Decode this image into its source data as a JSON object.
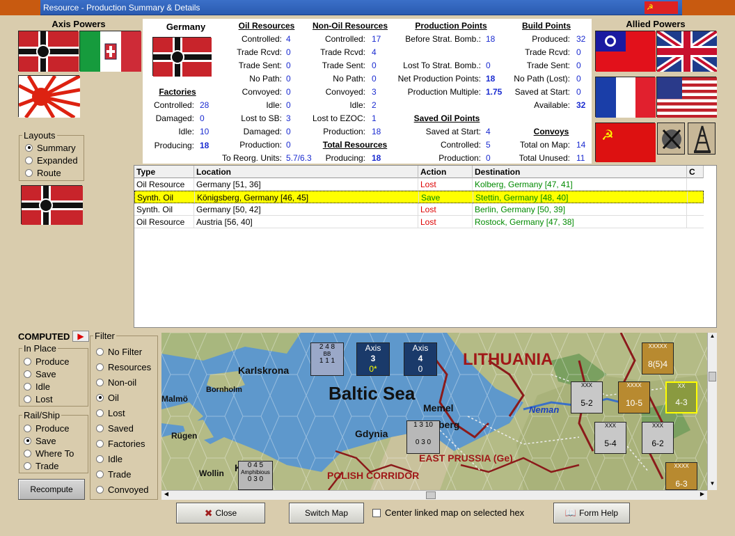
{
  "window": {
    "title": "Resource - Production Summary & Details"
  },
  "axis": {
    "title": "Axis Powers"
  },
  "allied": {
    "title": "Allied Powers"
  },
  "layouts": {
    "title": "Layouts",
    "options": [
      "Summary",
      "Expanded",
      "Route"
    ],
    "selected": "Summary"
  },
  "country": {
    "name": "Germany"
  },
  "factories": {
    "title": "Factories",
    "rows": [
      {
        "label": "Controlled:",
        "value": "28"
      },
      {
        "label": "Damaged:",
        "value": "0"
      },
      {
        "label": "Idle:",
        "value": "10"
      },
      {
        "label": "Producing:",
        "value": "18"
      }
    ]
  },
  "oil": {
    "title": "Oil Resources",
    "rows": [
      {
        "label": "Controlled:",
        "value": "4"
      },
      {
        "label": "Trade Rcvd:",
        "value": "0"
      },
      {
        "label": "Trade Sent:",
        "value": "0"
      },
      {
        "label": "No Path:",
        "value": "0"
      },
      {
        "label": "Convoyed:",
        "value": "0"
      },
      {
        "label": "Idle:",
        "value": "0"
      },
      {
        "label": "Lost to SB:",
        "value": "3"
      },
      {
        "label": "Damaged:",
        "value": "0"
      },
      {
        "label": "Production:",
        "value": "0"
      },
      {
        "label": "To Reorg. Units:",
        "value": "5.7/6.3"
      }
    ]
  },
  "nonoil": {
    "title": "Non-Oil Resources",
    "rows": [
      {
        "label": "Controlled:",
        "value": "17"
      },
      {
        "label": "Trade Rcvd:",
        "value": "4"
      },
      {
        "label": "Trade Sent:",
        "value": "0"
      },
      {
        "label": "No Path:",
        "value": "0"
      },
      {
        "label": "Convoyed:",
        "value": "3"
      },
      {
        "label": "Idle:",
        "value": "2"
      },
      {
        "label": "Lost to EZOC:",
        "value": "1"
      },
      {
        "label": "Production:",
        "value": "18"
      }
    ]
  },
  "total": {
    "title": "Total Resources",
    "label": "Producing:",
    "value": "18"
  },
  "production": {
    "title": "Production Points",
    "rows": [
      {
        "label": "Before Strat. Bomb.:",
        "value": "18"
      },
      {
        "label": "Lost To Strat. Bomb.:",
        "value": "0"
      },
      {
        "label": "Net Production Points:",
        "value": "18"
      },
      {
        "label": "Production Multiple:",
        "value": "1.75"
      }
    ]
  },
  "savedoil": {
    "title": "Saved Oil Points",
    "rows": [
      {
        "label": "Saved at Start:",
        "value": "4"
      },
      {
        "label": "Controlled:",
        "value": "5"
      },
      {
        "label": "Production:",
        "value": "0"
      }
    ]
  },
  "build": {
    "title": "Build Points",
    "rows": [
      {
        "label": "Produced:",
        "value": "32"
      },
      {
        "label": "Trade Rcvd:",
        "value": "0"
      },
      {
        "label": "Trade Sent:",
        "value": "0"
      },
      {
        "label": "No Path (Lost):",
        "value": "0"
      },
      {
        "label": "Saved at Start:",
        "value": "0"
      },
      {
        "label": "Available:",
        "value": "32"
      }
    ]
  },
  "convoys": {
    "title": "Convoys",
    "rows": [
      {
        "label": "Total on Map:",
        "value": "14"
      },
      {
        "label": "Total Unused:",
        "value": "11"
      }
    ]
  },
  "table": {
    "headers": [
      "Type",
      "Location",
      "Action",
      "Destination",
      "C"
    ],
    "rows": [
      {
        "type": "Oil Resource",
        "location": "Germany [51, 36]",
        "action": "Lost",
        "destination": "Kolberg, Germany [47, 41]"
      },
      {
        "type": "Synth. Oil",
        "location": "Königsberg, Germany [46, 45]",
        "action": "Save",
        "destination": "Stettin, Germany [48, 40]"
      },
      {
        "type": "Synth. Oil",
        "location": "Germany [50, 42]",
        "action": "Lost",
        "destination": "Berlin, Germany [50, 39]"
      },
      {
        "type": "Oil Resource",
        "location": "Austria [56, 40]",
        "action": "Lost",
        "destination": "Rostock, Germany [47, 38]"
      }
    ]
  },
  "computed": {
    "label": "COMPUTED"
  },
  "inplace": {
    "title": "In Place",
    "options": [
      "Produce",
      "Save",
      "Idle",
      "Lost"
    ],
    "selected": ""
  },
  "railship": {
    "title": "Rail/Ship",
    "options": [
      "Produce",
      "Save",
      "Where To",
      "Trade"
    ],
    "selected": "Save"
  },
  "filter": {
    "title": "Filter",
    "options": [
      "No Filter",
      "Resources",
      "Non-oil",
      "Oil",
      "Lost",
      "Saved",
      "Factories",
      "Idle",
      "Trade",
      "Convoyed"
    ],
    "selected": "Oil"
  },
  "recompute": {
    "label": "Recompute"
  },
  "map": {
    "labels": {
      "baltic": "Baltic Sea",
      "lithuania": "LITHUANIA",
      "karlskrona": "Karlskrona",
      "bornholm": "Bornholm",
      "malmo": "Malmö",
      "memel": "Memel",
      "gdynia": "Gdynia",
      "berg": "berg",
      "rugen": "Rügen",
      "wollin": "Wollin",
      "eastprussia": "EAST PRUSSIA (Ge)",
      "polish": "POLISH CORRIDOR",
      "neman": "Neman",
      "k": "K"
    },
    "axis_boxes": [
      {
        "t": "Axis",
        "n": "3",
        "s": "0*"
      },
      {
        "t": "Axis",
        "n": "4",
        "s": "0"
      }
    ],
    "units": [
      {
        "top": "2  4  8",
        "mid": "BB",
        "bot": "1  1  1"
      },
      {
        "top": "1  3  10",
        "mid": "",
        "bot": "0  3  0"
      },
      {
        "top": "0  4  5",
        "mid": "Amphibious",
        "bot": "0  3  0"
      },
      {
        "top": "XXXXX",
        "mid": "",
        "bot": "8(5)4"
      },
      {
        "top": "XXX",
        "mid": "",
        "bot": "5-2"
      },
      {
        "top": "XXXX",
        "mid": "",
        "bot": "10-5"
      },
      {
        "top": "XX",
        "mid": "",
        "bot": "4-3"
      },
      {
        "top": "XXX",
        "mid": "",
        "bot": "5-4"
      },
      {
        "top": "XXX",
        "mid": "",
        "bot": "6-2"
      },
      {
        "top": "XXXX",
        "mid": "",
        "bot": "6-3"
      }
    ]
  },
  "buttons": {
    "close": "Close",
    "switch": "Switch Map",
    "center": "Center linked map on selected hex",
    "help": "Form Help"
  },
  "colors": {
    "highlight": "#ffff00",
    "lost": "#dd0000",
    "save": "#008a00",
    "value": "#1a2bd0"
  }
}
